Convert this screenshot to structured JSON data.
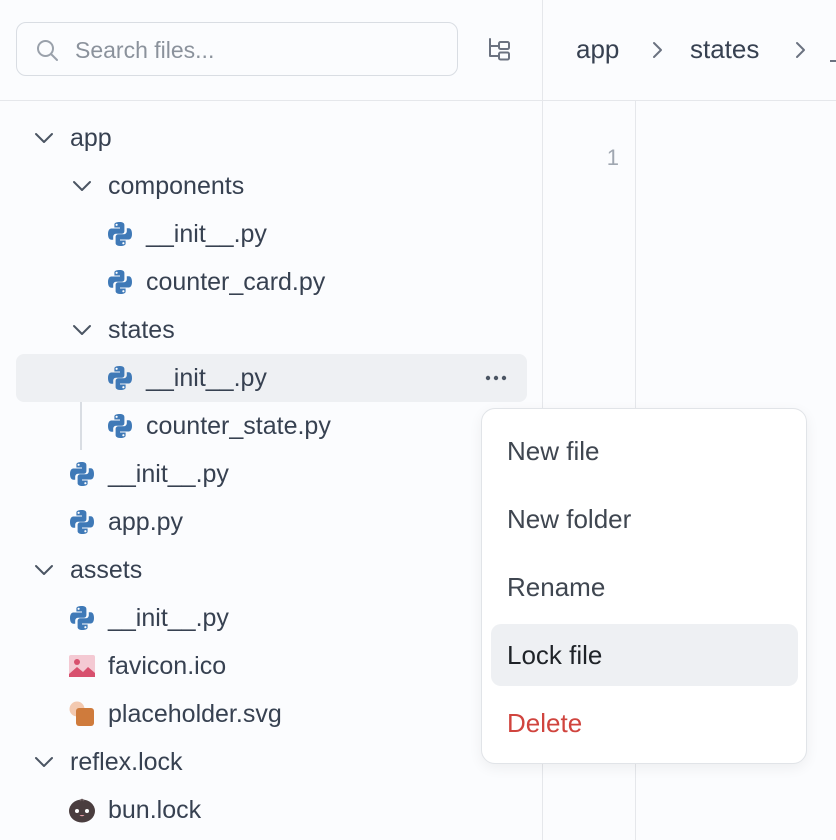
{
  "search": {
    "placeholder": "Search files..."
  },
  "breadcrumb": {
    "items": [
      "app",
      "states"
    ]
  },
  "editor": {
    "line_numbers": [
      "1"
    ]
  },
  "tree": [
    {
      "label": "app",
      "kind": "folder",
      "icon": "chevron-down-icon"
    },
    {
      "label": "components",
      "kind": "folder",
      "icon": "chevron-down-icon"
    },
    {
      "label": "__init__.py",
      "kind": "file",
      "icon": "python-icon"
    },
    {
      "label": "counter_card.py",
      "kind": "file",
      "icon": "python-icon"
    },
    {
      "label": "states",
      "kind": "folder",
      "icon": "chevron-down-icon"
    },
    {
      "label": "__init__.py",
      "kind": "file",
      "icon": "python-icon",
      "selected": true
    },
    {
      "label": "counter_state.py",
      "kind": "file",
      "icon": "python-icon"
    },
    {
      "label": "__init__.py",
      "kind": "file",
      "icon": "python-icon"
    },
    {
      "label": "app.py",
      "kind": "file",
      "icon": "python-icon"
    },
    {
      "label": "assets",
      "kind": "folder",
      "icon": "chevron-down-icon"
    },
    {
      "label": "__init__.py",
      "kind": "file",
      "icon": "python-icon"
    },
    {
      "label": "favicon.ico",
      "kind": "file",
      "icon": "image-icon"
    },
    {
      "label": "placeholder.svg",
      "kind": "file",
      "icon": "shapes-icon"
    },
    {
      "label": "reflex.lock",
      "kind": "folder",
      "icon": "chevron-down-icon"
    },
    {
      "label": "bun.lock",
      "kind": "file",
      "icon": "bun-icon"
    }
  ],
  "context_menu": {
    "items": [
      {
        "label": "New file"
      },
      {
        "label": "New folder"
      },
      {
        "label": "Rename"
      },
      {
        "label": "Lock file",
        "highlighted": true
      },
      {
        "label": "Delete",
        "danger": true
      }
    ]
  },
  "colors": {
    "danger": "#d0443e",
    "python_blue": "#3f79b7",
    "python_gold": "#f2c53d",
    "selection": "#eef0f3"
  }
}
